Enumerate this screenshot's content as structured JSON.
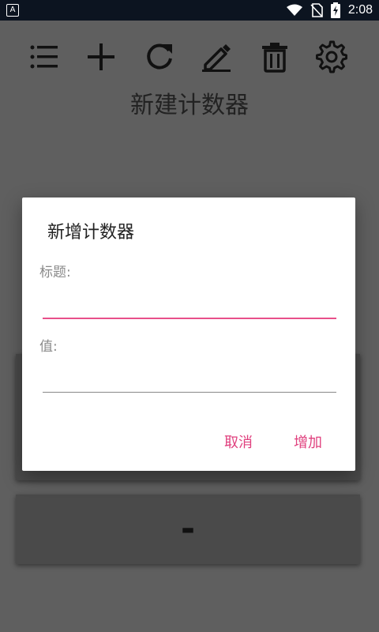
{
  "status_bar": {
    "time": "2:08",
    "app_badge": "A",
    "icons": [
      "wifi-icon",
      "no-sim-icon",
      "battery-charging-icon"
    ]
  },
  "toolbar": {
    "icons": [
      "list-icon",
      "add-icon",
      "refresh-icon",
      "edit-icon",
      "delete-icon",
      "settings-icon"
    ]
  },
  "page": {
    "title": "新建计数器"
  },
  "counter_card": {
    "minus_label": "-"
  },
  "dialog": {
    "title": "新增计数器",
    "title_label": "标题:",
    "title_value": "",
    "value_label": "值:",
    "value_value": "",
    "cancel_label": "取消",
    "add_label": "增加"
  },
  "colors": {
    "accent": "#e0407e",
    "status_bar": "#0c1420",
    "scrim_background": "#5f5f5f"
  }
}
